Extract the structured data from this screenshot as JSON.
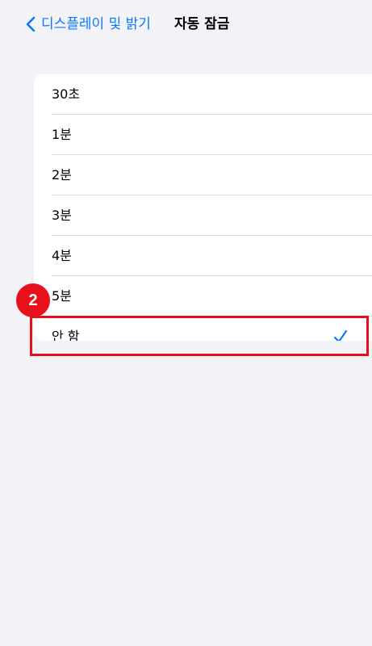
{
  "nav": {
    "back_label": "디스플레이 및 밝기",
    "title": "자동 잠금"
  },
  "options": [
    {
      "label": "30초",
      "selected": false
    },
    {
      "label": "1분",
      "selected": false
    },
    {
      "label": "2분",
      "selected": false
    },
    {
      "label": "3분",
      "selected": false
    },
    {
      "label": "4분",
      "selected": false
    },
    {
      "label": "5분",
      "selected": false
    },
    {
      "label": "안 함",
      "selected": true
    }
  ],
  "annotation": {
    "step_number": "2",
    "highlight_color": "#e8101a"
  },
  "colors": {
    "accent": "#0a7aff",
    "background": "#f2f2f7",
    "card": "#ffffff"
  },
  "icons": {
    "back": "chevron-left-icon",
    "selected": "checkmark-icon"
  }
}
